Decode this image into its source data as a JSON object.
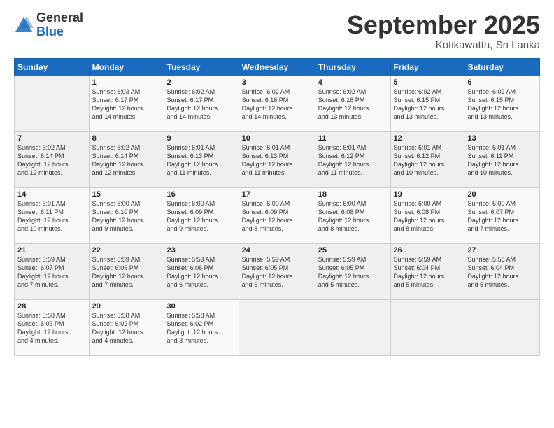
{
  "logo": {
    "general": "General",
    "blue": "Blue"
  },
  "title": "September 2025",
  "subtitle": "Kotikawatta, Sri Lanka",
  "headers": [
    "Sunday",
    "Monday",
    "Tuesday",
    "Wednesday",
    "Thursday",
    "Friday",
    "Saturday"
  ],
  "weeks": [
    [
      {
        "day": "",
        "info": ""
      },
      {
        "day": "1",
        "info": "Sunrise: 6:03 AM\nSunset: 6:17 PM\nDaylight: 12 hours\nand 14 minutes."
      },
      {
        "day": "2",
        "info": "Sunrise: 6:02 AM\nSunset: 6:17 PM\nDaylight: 12 hours\nand 14 minutes."
      },
      {
        "day": "3",
        "info": "Sunrise: 6:02 AM\nSunset: 6:16 PM\nDaylight: 12 hours\nand 14 minutes."
      },
      {
        "day": "4",
        "info": "Sunrise: 6:02 AM\nSunset: 6:16 PM\nDaylight: 12 hours\nand 13 minutes."
      },
      {
        "day": "5",
        "info": "Sunrise: 6:02 AM\nSunset: 6:15 PM\nDaylight: 12 hours\nand 13 minutes."
      },
      {
        "day": "6",
        "info": "Sunrise: 6:02 AM\nSunset: 6:15 PM\nDaylight: 12 hours\nand 13 minutes."
      }
    ],
    [
      {
        "day": "7",
        "info": "Sunrise: 6:02 AM\nSunset: 6:14 PM\nDaylight: 12 hours\nand 12 minutes."
      },
      {
        "day": "8",
        "info": "Sunrise: 6:02 AM\nSunset: 6:14 PM\nDaylight: 12 hours\nand 12 minutes."
      },
      {
        "day": "9",
        "info": "Sunrise: 6:01 AM\nSunset: 6:13 PM\nDaylight: 12 hours\nand 11 minutes."
      },
      {
        "day": "10",
        "info": "Sunrise: 6:01 AM\nSunset: 6:13 PM\nDaylight: 12 hours\nand 11 minutes."
      },
      {
        "day": "11",
        "info": "Sunrise: 6:01 AM\nSunset: 6:12 PM\nDaylight: 12 hours\nand 11 minutes."
      },
      {
        "day": "12",
        "info": "Sunrise: 6:01 AM\nSunset: 6:12 PM\nDaylight: 12 hours\nand 10 minutes."
      },
      {
        "day": "13",
        "info": "Sunrise: 6:01 AM\nSunset: 6:11 PM\nDaylight: 12 hours\nand 10 minutes."
      }
    ],
    [
      {
        "day": "14",
        "info": "Sunrise: 6:01 AM\nSunset: 6:11 PM\nDaylight: 12 hours\nand 10 minutes."
      },
      {
        "day": "15",
        "info": "Sunrise: 6:00 AM\nSunset: 6:10 PM\nDaylight: 12 hours\nand 9 minutes."
      },
      {
        "day": "16",
        "info": "Sunrise: 6:00 AM\nSunset: 6:09 PM\nDaylight: 12 hours\nand 9 minutes."
      },
      {
        "day": "17",
        "info": "Sunrise: 6:00 AM\nSunset: 6:09 PM\nDaylight: 12 hours\nand 8 minutes."
      },
      {
        "day": "18",
        "info": "Sunrise: 6:00 AM\nSunset: 6:08 PM\nDaylight: 12 hours\nand 8 minutes."
      },
      {
        "day": "19",
        "info": "Sunrise: 6:00 AM\nSunset: 6:08 PM\nDaylight: 12 hours\nand 8 minutes."
      },
      {
        "day": "20",
        "info": "Sunrise: 6:00 AM\nSunset: 6:07 PM\nDaylight: 12 hours\nand 7 minutes."
      }
    ],
    [
      {
        "day": "21",
        "info": "Sunrise: 5:59 AM\nSunset: 6:07 PM\nDaylight: 12 hours\nand 7 minutes."
      },
      {
        "day": "22",
        "info": "Sunrise: 5:59 AM\nSunset: 6:06 PM\nDaylight: 12 hours\nand 7 minutes."
      },
      {
        "day": "23",
        "info": "Sunrise: 5:59 AM\nSunset: 6:06 PM\nDaylight: 12 hours\nand 6 minutes."
      },
      {
        "day": "24",
        "info": "Sunrise: 5:59 AM\nSunset: 6:05 PM\nDaylight: 12 hours\nand 6 minutes."
      },
      {
        "day": "25",
        "info": "Sunrise: 5:59 AM\nSunset: 6:05 PM\nDaylight: 12 hours\nand 5 minutes."
      },
      {
        "day": "26",
        "info": "Sunrise: 5:59 AM\nSunset: 6:04 PM\nDaylight: 12 hours\nand 5 minutes."
      },
      {
        "day": "27",
        "info": "Sunrise: 5:58 AM\nSunset: 6:04 PM\nDaylight: 12 hours\nand 5 minutes."
      }
    ],
    [
      {
        "day": "28",
        "info": "Sunrise: 5:58 AM\nSunset: 6:03 PM\nDaylight: 12 hours\nand 4 minutes."
      },
      {
        "day": "29",
        "info": "Sunrise: 5:58 AM\nSunset: 6:02 PM\nDaylight: 12 hours\nand 4 minutes."
      },
      {
        "day": "30",
        "info": "Sunrise: 5:58 AM\nSunset: 6:02 PM\nDaylight: 12 hours\nand 3 minutes."
      },
      {
        "day": "",
        "info": ""
      },
      {
        "day": "",
        "info": ""
      },
      {
        "day": "",
        "info": ""
      },
      {
        "day": "",
        "info": ""
      }
    ]
  ]
}
